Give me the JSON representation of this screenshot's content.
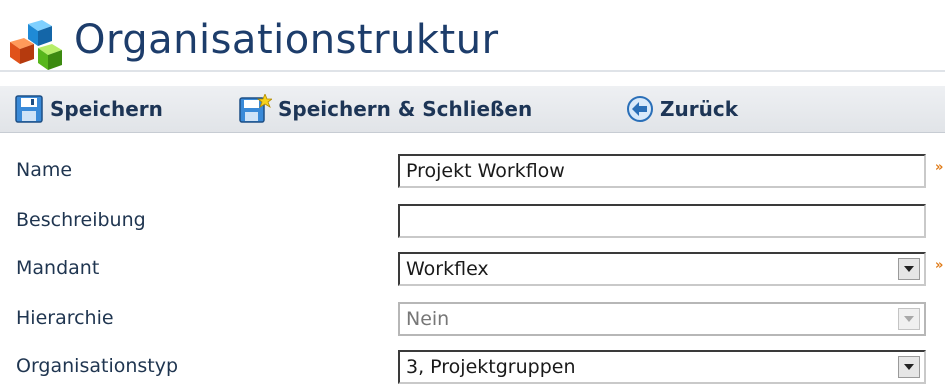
{
  "page": {
    "title": "Organisationstruktur",
    "logo_icon": "colored-cubes-icon"
  },
  "toolbar": {
    "save_label": "Speichern",
    "save_close_label": "Speichern & Schließen",
    "back_label": "Zurück",
    "save_icon": "floppy-disk-icon",
    "save_close_icon": "floppy-disk-star-icon",
    "back_icon": "back-arrow-icon"
  },
  "form": {
    "name": {
      "label": "Name",
      "value": "Projekt Workflow",
      "required_mark": "»"
    },
    "description": {
      "label": "Beschreibung",
      "value": ""
    },
    "tenant": {
      "label": "Mandant",
      "value": "Workflex",
      "required_mark": "»"
    },
    "hierarchy": {
      "label": "Hierarchie",
      "value": "Nein",
      "disabled": true
    },
    "org_type": {
      "label": "Organisationstyp",
      "value": "3, Projektgruppen"
    }
  },
  "colors": {
    "title": "#1d3d6b",
    "toolbar_bg": "#e6e9ed",
    "label_text": "#1f3550",
    "required_mark": "#e07b18"
  }
}
